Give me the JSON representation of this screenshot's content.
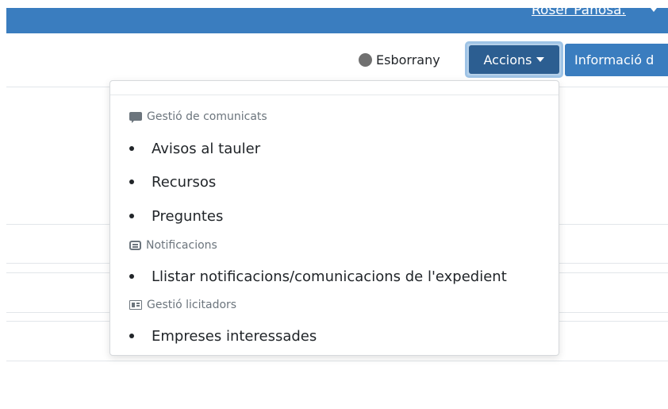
{
  "header": {
    "user_name": "Roser Pañosa."
  },
  "toolbar": {
    "status_label": "Esborrany",
    "actions_label": "Accions",
    "info_label": "Informació d"
  },
  "dropdown": {
    "sections": [
      {
        "title": "Gestió de comunicats",
        "icon": "comment-icon",
        "items": [
          "Avisos al tauler",
          "Recursos",
          "Preguntes"
        ]
      },
      {
        "title": "Notificacions",
        "icon": "envelope-icon",
        "items": [
          "Llistar notificacions/comunicacions de l'expedient"
        ]
      },
      {
        "title": "Gestió licitadors",
        "icon": "id-card-icon",
        "items": [
          "Empreses interessades"
        ]
      }
    ]
  },
  "colors": {
    "header_bg": "#3a7dbf",
    "actions_button_bg": "#2c5e91",
    "status_dot": "#707070"
  }
}
